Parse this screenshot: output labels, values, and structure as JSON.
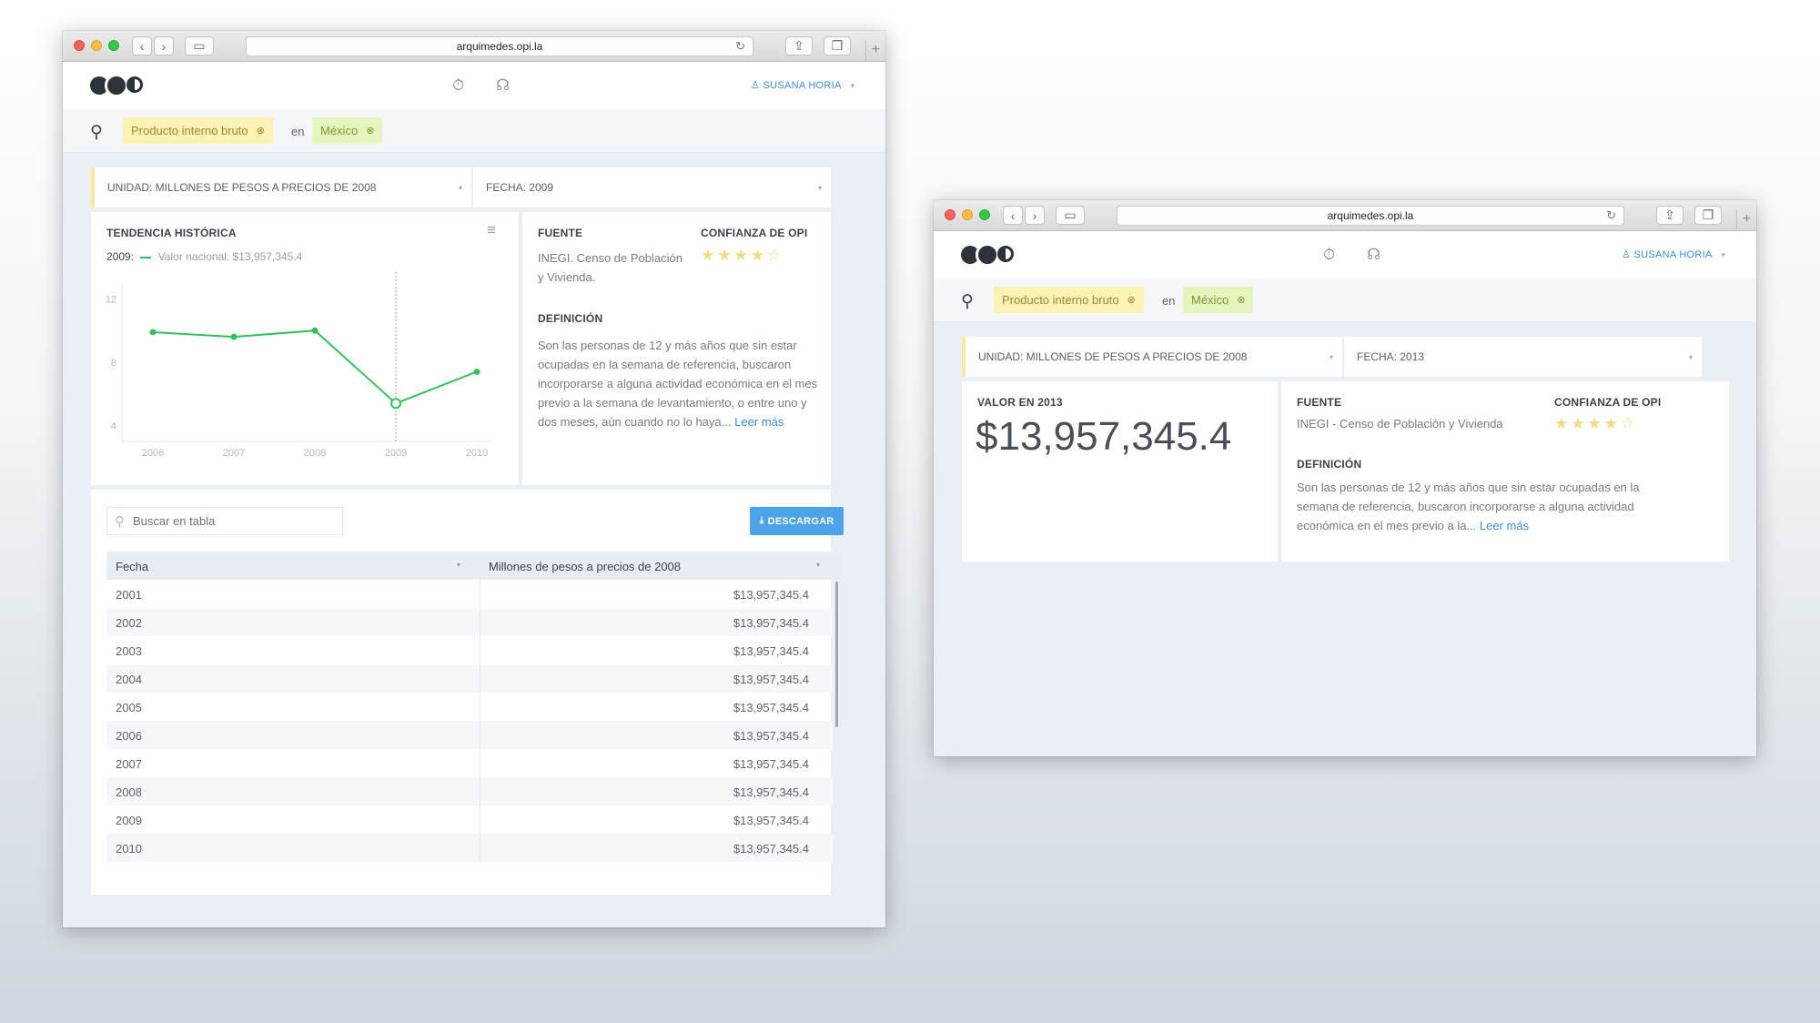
{
  "browser": {
    "url": "arquimedes.opi.la"
  },
  "app": {
    "user_name": "SUSANA HORIA",
    "search": {
      "indicator": "Producto interno bruto",
      "connector": "en",
      "location": "México"
    }
  },
  "window1": {
    "filters": {
      "unit": "UNIDAD: MILLONES DE PESOS A PRECIOS DE 2008",
      "date": "FECHA: 2009"
    },
    "trend": {
      "title": "TENDENCIA HISTÓRICA",
      "legend_year": "2009:",
      "legend_text": "Valor nacional: $13,957,345.4"
    },
    "source": {
      "label": "FUENTE",
      "value": "INEGI. Censo de Población y Vivienda.",
      "confidence_label": "CONFIANZA DE OPI",
      "definition_label": "DEFINICIÓN",
      "definition": "Son las personas de 12 y más años que sin estar ocupadas en la semana de referencia, buscaron incorporarse a alguna actividad económica en el mes previo a la semana de levantamiento, o entre uno y dos meses, aún cuando no lo haya...",
      "read_more": "Leer más"
    },
    "table": {
      "search_placeholder": "Buscar en tabla",
      "download_label": "DESCARGAR",
      "columns": [
        "Fecha",
        "Millones de pesos a precios de 2008"
      ],
      "rows": [
        [
          "2001",
          "$13,957,345.4"
        ],
        [
          "2002",
          "$13,957,345.4"
        ],
        [
          "2003",
          "$13,957,345.4"
        ],
        [
          "2004",
          "$13,957,345.4"
        ],
        [
          "2005",
          "$13,957,345.4"
        ],
        [
          "2006",
          "$13,957,345.4"
        ],
        [
          "2007",
          "$13,957,345.4"
        ],
        [
          "2008",
          "$13,957,345.4"
        ],
        [
          "2009",
          "$13,957,345.4"
        ],
        [
          "2010",
          "$13,957,345.4"
        ]
      ]
    }
  },
  "window2": {
    "filters": {
      "unit": "UNIDAD: MILLONES DE PESOS A PRECIOS DE 2008",
      "date": "FECHA: 2013"
    },
    "value": {
      "label": "VALOR EN 2013",
      "amount": "$13,957,345.4"
    },
    "source": {
      "label": "FUENTE",
      "value": "INEGI - Censo de Población y Vivienda",
      "confidence_label": "CONFIANZA DE OPI",
      "definition_label": "DEFINICIÓN",
      "definition": "Son las personas de 12 y más años que sin estar ocupadas en la semana de referencia, buscaron incorporarse a alguna actividad económica en el mes previo a la...",
      "read_more": "Leer más"
    }
  },
  "chart_data": {
    "type": "line",
    "x": [
      "2006",
      "2007",
      "2008",
      "2009",
      "2010"
    ],
    "values": [
      9.9,
      9.6,
      10.0,
      5.4,
      7.4
    ],
    "ylim": [
      3,
      13
    ],
    "yticks": [
      4,
      8,
      12
    ],
    "highlight_x": "2009",
    "grid": false,
    "color": "#2fc35a"
  },
  "colors": {
    "accent": "#3a8fde",
    "chart_line": "#2fc35a",
    "chip_yellow": "#fbf2b3",
    "chip_green": "#e6f5bd"
  },
  "icons": {
    "timer": "stopwatch-icon",
    "support": "headset-icon",
    "user": "user-icon",
    "search": "magnifier-icon",
    "menu": "hamburger-menu-icon",
    "download": "download-icon"
  }
}
